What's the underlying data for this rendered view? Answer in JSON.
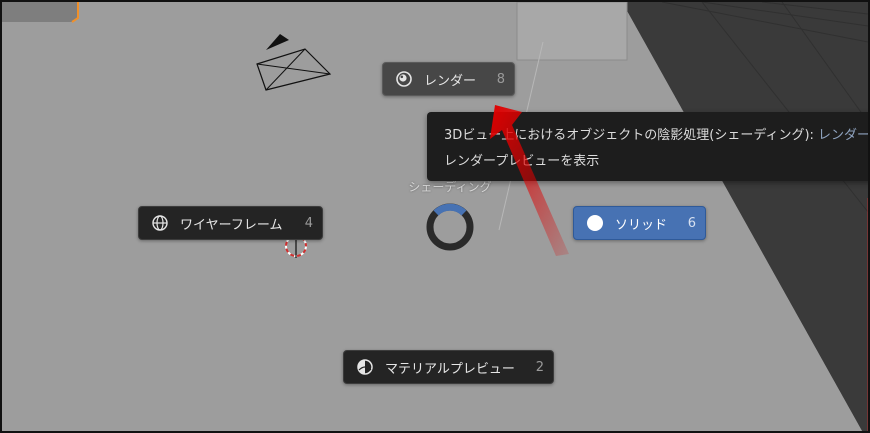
{
  "pie_menu": {
    "title": "シェーディング",
    "items": [
      {
        "label": "レンダー",
        "key": "8",
        "icon": "render-shading-icon",
        "state": "hover"
      },
      {
        "label": "ワイヤーフレーム",
        "key": "4",
        "icon": "wireframe-icon",
        "state": "normal"
      },
      {
        "label": "ソリッド",
        "key": "6",
        "icon": "solid-shading-icon",
        "state": "active"
      },
      {
        "label": "マテリアルプレビュー",
        "key": "2",
        "icon": "material-preview-icon",
        "state": "normal"
      }
    ]
  },
  "tooltip": {
    "line1_prefix": "3Dビュー上におけるオブジェクトの陰影処理(シェーディング):",
    "line1_value": "レンダー",
    "line2": "レンダープレビューを表示"
  },
  "colors": {
    "viewport_bg": "#9a9a9a",
    "pill_bg": "#242424",
    "pill_active": "#4772b3",
    "pill_hover": "#474747",
    "selection_orange": "#f0902a",
    "annotation_arrow": "#e00000"
  }
}
